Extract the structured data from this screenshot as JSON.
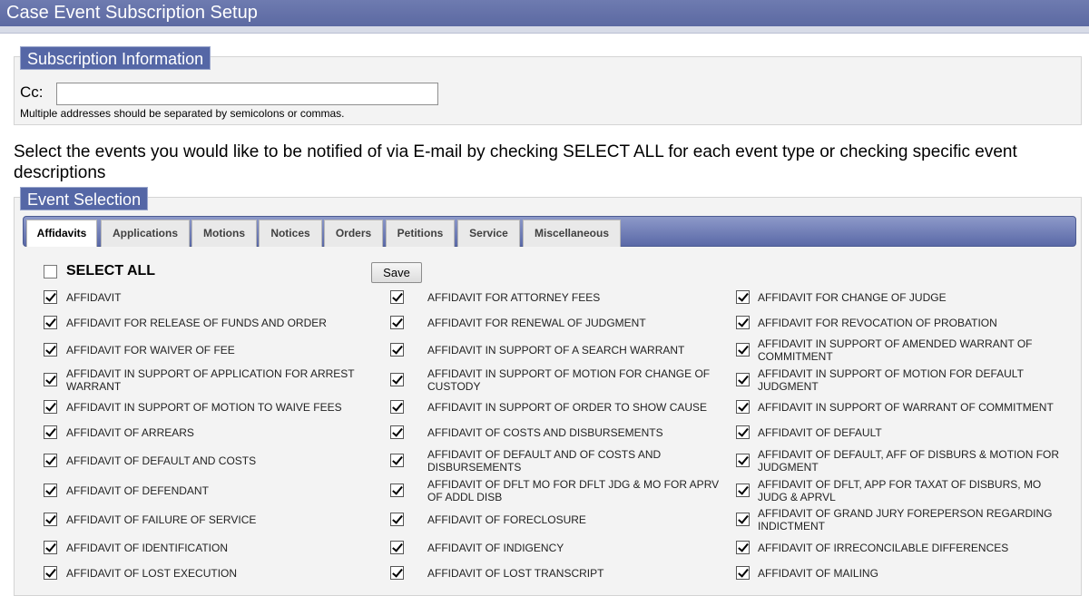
{
  "window": {
    "title": "Case Event Subscription Setup"
  },
  "subscription": {
    "legend": "Subscription Information",
    "cc_label": "Cc:",
    "cc_value": "",
    "hint": "Multiple addresses should be separated by semicolons or commas."
  },
  "intro_text": "Select the events you would like to be notified of via E-mail by checking SELECT ALL for each event type or checking specific event descriptions",
  "event_selection": {
    "legend": "Event Selection",
    "tabs": [
      "Affidavits",
      "Applications",
      "Motions",
      "Notices",
      "Orders",
      "Petitions",
      "Service",
      "Miscellaneous"
    ],
    "active_tab": "Affidavits",
    "select_all_label": "SELECT ALL",
    "select_all_checked": false,
    "save_label": "Save",
    "items": [
      [
        "AFFIDAVIT",
        "AFFIDAVIT FOR ATTORNEY FEES",
        "AFFIDAVIT FOR CHANGE OF JUDGE"
      ],
      [
        "AFFIDAVIT FOR RELEASE OF FUNDS AND ORDER",
        "AFFIDAVIT FOR RENEWAL OF JUDGMENT",
        "AFFIDAVIT FOR REVOCATION OF PROBATION"
      ],
      [
        "AFFIDAVIT FOR WAIVER OF FEE",
        "AFFIDAVIT IN SUPPORT OF A SEARCH WARRANT",
        "AFFIDAVIT IN SUPPORT OF AMENDED WARRANT OF COMMITMENT"
      ],
      [
        "AFFIDAVIT IN SUPPORT OF APPLICATION FOR ARREST WARRANT",
        "AFFIDAVIT IN SUPPORT OF MOTION FOR CHANGE OF CUSTODY",
        "AFFIDAVIT IN SUPPORT OF MOTION FOR DEFAULT JUDGMENT"
      ],
      [
        "AFFIDAVIT IN SUPPORT OF MOTION TO WAIVE FEES",
        "AFFIDAVIT IN SUPPORT OF ORDER TO SHOW CAUSE",
        "AFFIDAVIT IN SUPPORT OF WARRANT OF COMMITMENT"
      ],
      [
        "AFFIDAVIT OF ARREARS",
        "AFFIDAVIT OF COSTS AND DISBURSEMENTS",
        "AFFIDAVIT OF DEFAULT"
      ],
      [
        "AFFIDAVIT OF DEFAULT AND COSTS",
        "AFFIDAVIT OF DEFAULT AND OF COSTS AND DISBURSEMENTS",
        "AFFIDAVIT OF DEFAULT, AFF OF DISBURS & MOTION FOR JUDGMENT"
      ],
      [
        "AFFIDAVIT OF DEFENDANT",
        "AFFIDAVIT OF DFLT MO FOR DFLT JDG & MO FOR APRV OF ADDL DISB",
        "AFFIDAVIT OF DFLT, APP FOR TAXAT OF DISBURS, MO JUDG & APRVL"
      ],
      [
        "AFFIDAVIT OF FAILURE OF SERVICE",
        "AFFIDAVIT OF FORECLOSURE",
        "AFFIDAVIT OF GRAND JURY FOREPERSON REGARDING INDICTMENT"
      ],
      [
        "AFFIDAVIT OF IDENTIFICATION",
        "AFFIDAVIT OF INDIGENCY",
        "AFFIDAVIT OF IRRECONCILABLE DIFFERENCES"
      ],
      [
        "AFFIDAVIT OF LOST EXECUTION",
        "AFFIDAVIT OF LOST TRANSCRIPT",
        "AFFIDAVIT OF MAILING"
      ]
    ]
  }
}
